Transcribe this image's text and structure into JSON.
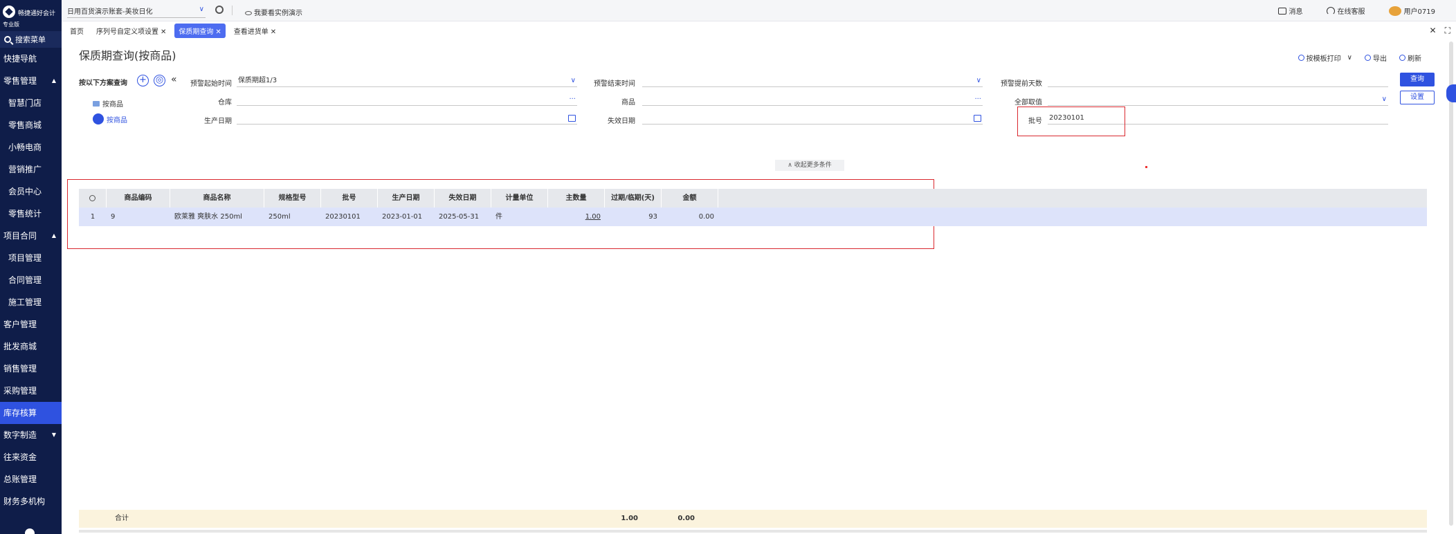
{
  "sidebar": {
    "brand": "畅捷通好会计",
    "edition": "专业版",
    "search_label": "搜索菜单",
    "items": [
      {
        "label": "快捷导航"
      },
      {
        "label": "零售管理",
        "caret": "▲"
      },
      {
        "label": "智慧门店"
      },
      {
        "label": "零售商城"
      },
      {
        "label": "小畅电商"
      },
      {
        "label": "营销推广"
      },
      {
        "label": "会员中心"
      },
      {
        "label": "零售统计"
      },
      {
        "label": "项目合同",
        "caret": "▲"
      },
      {
        "label": "项目管理"
      },
      {
        "label": "合同管理"
      },
      {
        "label": "施工管理"
      },
      {
        "label": "客户管理"
      },
      {
        "label": "批发商城"
      },
      {
        "label": "销售管理"
      },
      {
        "label": "采购管理"
      },
      {
        "label": "库存核算"
      },
      {
        "label": "数字制造",
        "caret": "▼"
      },
      {
        "label": "往来资金"
      },
      {
        "label": "总账管理"
      },
      {
        "label": "财务多机构"
      }
    ]
  },
  "topbar": {
    "account": "日用百货演示账套-美妆日化",
    "demo_link": "我要看实例演示",
    "messages": "消息",
    "service": "在线客服",
    "user": "用户0719"
  },
  "tabs": [
    {
      "label": "首页",
      "closable": false
    },
    {
      "label": "序列号自定义项设置",
      "closable": true
    },
    {
      "label": "保质期查询",
      "closable": true,
      "active": true
    },
    {
      "label": "查看进货单",
      "closable": true
    }
  ],
  "tabs_controls": {
    "close_all": "✕",
    "fullscreen": "⛶"
  },
  "page": {
    "title": "保质期查询(按商品)",
    "actions": {
      "print": "按模板打印",
      "export": "导出",
      "refresh": "刷新"
    }
  },
  "filters": {
    "scheme_title": "按以下方案查询",
    "schemes": [
      "按商品",
      "按商品"
    ],
    "warn_start_label": "预警起始时间",
    "warn_start_value": "保质期超1/3",
    "warn_end_label": "预警结束时间",
    "warn_end_value": "",
    "warn_days_label": "预警提前天数",
    "warn_days_value": "",
    "warehouse_label": "仓库",
    "warehouse_value": "",
    "product_label": "商品",
    "product_value": "",
    "status_label": "全部取值",
    "status_value": "",
    "prod_date_label": "生产日期",
    "prod_date_value": "",
    "exp_date_label": "失效日期",
    "exp_date_value": "",
    "batch_label": "批号",
    "batch_value": "20230101",
    "query_button": "查询",
    "settings_button": "设置",
    "collapse_more": "收起更多条件",
    "ellipsis": "···"
  },
  "table": {
    "columns": [
      "商品编码",
      "商品名称",
      "规格型号",
      "批号",
      "生产日期",
      "失效日期",
      "计量单位",
      "主数量",
      "过期/临期(天)",
      "金额"
    ],
    "rows": [
      [
        "1",
        "9",
        "欧莱雅 爽肤水 250ml",
        "250ml",
        "20230101",
        "2023-01-01",
        "2025-05-31",
        "件",
        "1.00",
        "93",
        "0.00"
      ]
    ],
    "total_label": "合计",
    "total_qty": "1.00",
    "total_amount": "0.00"
  },
  "colors": {
    "sidebar_bg": "#0f1d49",
    "primary": "#2f52e0",
    "highlight": "#d9272e"
  }
}
